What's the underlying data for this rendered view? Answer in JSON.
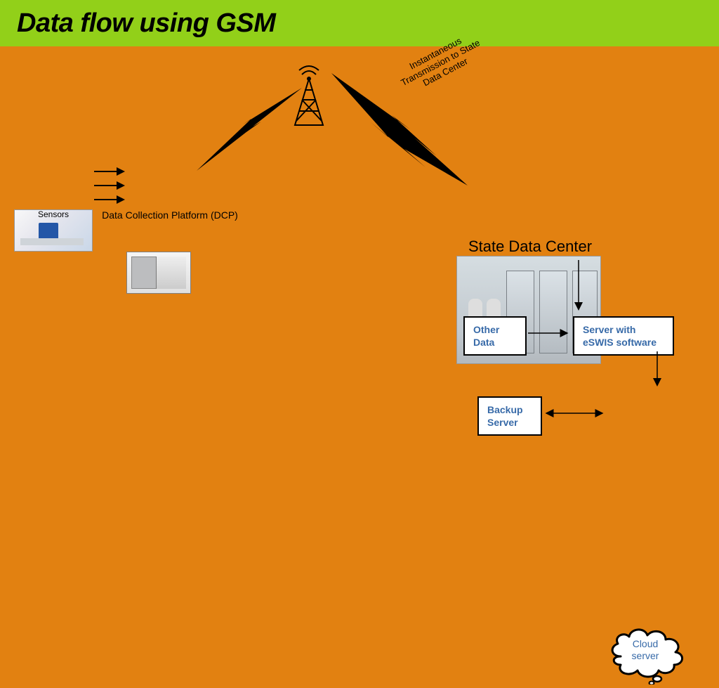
{
  "title": "Data flow using GSM",
  "labels": {
    "sensors": "Sensors",
    "dcp": "Data Collection Platform (DCP)",
    "transmission": "Instantaneous\nTransmission to State\nData Center",
    "state_data_center": "State Data Center"
  },
  "boxes": {
    "other_data": "Other\nData",
    "server_eswis": "Server with\neSWIS software",
    "backup_server": "Backup\nServer",
    "cloud_server": "Cloud\nserver"
  }
}
